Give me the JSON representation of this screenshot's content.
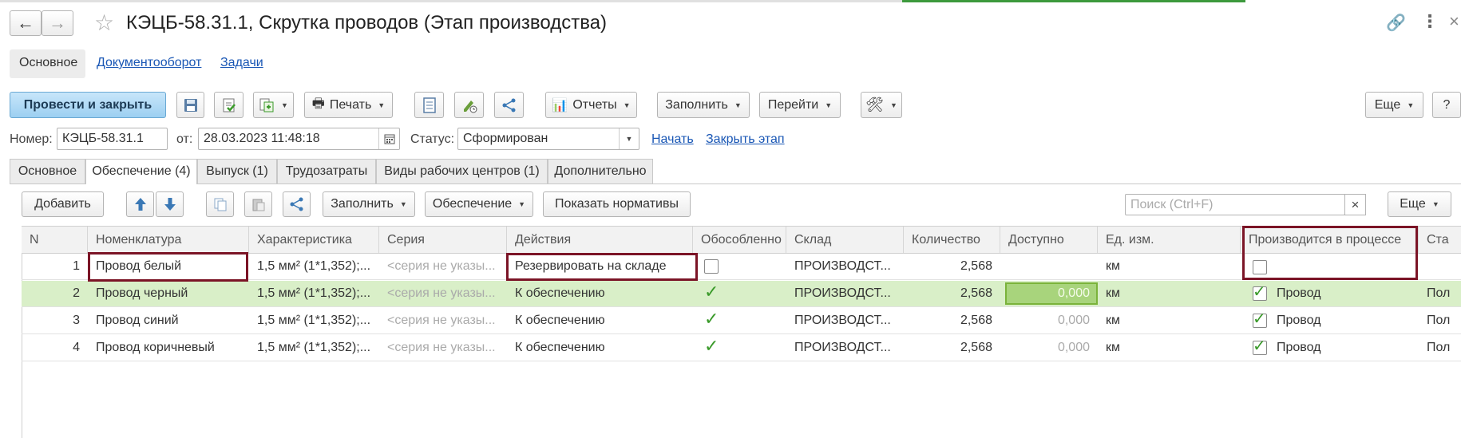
{
  "window": {
    "title": "КЭЦБ-58.31.1, Скрутка проводов (Этап производства)"
  },
  "nav": {
    "back": "←",
    "forward": "→"
  },
  "section_tabs": [
    {
      "label": "Основное"
    },
    {
      "label": "Документооборот"
    },
    {
      "label": "Задачи"
    }
  ],
  "toolbar": {
    "post_close": "Провести и закрыть",
    "print": "Печать",
    "reports": "Отчеты",
    "fill": "Заполнить",
    "goto": "Перейти",
    "more": "Еще",
    "help": "?"
  },
  "header_fields": {
    "number_label": "Номер:",
    "number_value": "КЭЦБ-58.31.1",
    "date_label": "от:",
    "date_value": "28.03.2023 11:48:18",
    "status_label": "Статус:",
    "status_value": "Сформирован",
    "start_link": "Начать",
    "close_stage_link": "Закрыть этап"
  },
  "tabs": [
    {
      "label": "Основное"
    },
    {
      "label": "Обеспечение (4)"
    },
    {
      "label": "Выпуск (1)"
    },
    {
      "label": "Трудозатраты"
    },
    {
      "label": "Виды рабочих центров (1)"
    },
    {
      "label": "Дополнительно"
    }
  ],
  "table_toolbar": {
    "add": "Добавить",
    "fill": "Заполнить",
    "supply": "Обеспечение",
    "show_norms": "Показать нормативы",
    "search_placeholder": "Поиск (Ctrl+F)",
    "more": "Еще"
  },
  "table": {
    "columns": [
      "N",
      "Номенклатура",
      "Характеристика",
      "Серия",
      "Действия",
      "Обособленно",
      "Склад",
      "Количество",
      "Доступно",
      "Ед. изм.",
      "Производится в процессе",
      "Ста"
    ],
    "rows": [
      {
        "n": "1",
        "item": "Провод белый",
        "char": "1,5 мм² (1*1,352);...",
        "series": "<серия не указы...",
        "action": "Резервировать на складе",
        "separate": false,
        "warehouse": "ПРОИЗВОДСТ...",
        "qty": "2,568",
        "available": "",
        "unit": "км",
        "in_process": false,
        "in_process_label": "",
        "status": ""
      },
      {
        "n": "2",
        "item": "Провод черный",
        "char": "1,5 мм² (1*1,352);...",
        "series": "<серия не указы...",
        "action": "К обеспечению",
        "separate": true,
        "warehouse": "ПРОИЗВОДСТ...",
        "qty": "2,568",
        "available": "0,000",
        "unit": "км",
        "in_process": true,
        "in_process_label": "Провод",
        "status": "Пол"
      },
      {
        "n": "3",
        "item": "Провод синий",
        "char": "1,5 мм² (1*1,352);...",
        "series": "<серия не указы...",
        "action": "К обеспечению",
        "separate": true,
        "warehouse": "ПРОИЗВОДСТ...",
        "qty": "2,568",
        "available": "0,000",
        "unit": "км",
        "in_process": true,
        "in_process_label": "Провод",
        "status": "Пол"
      },
      {
        "n": "4",
        "item": "Провод коричневый",
        "char": "1,5 мм² (1*1,352);...",
        "series": "<серия не указы...",
        "action": "К обеспечению",
        "separate": true,
        "warehouse": "ПРОИЗВОДСТ...",
        "qty": "2,568",
        "available": "0,000",
        "unit": "км",
        "in_process": true,
        "in_process_label": "Провод",
        "status": "Пол"
      }
    ]
  },
  "colors": {
    "selected_row": "#d9efc8",
    "highlight_box": "#7b1426",
    "primary_button": "#9ccff1",
    "link": "#1a57b5",
    "checkmark": "#3a9a2a"
  }
}
